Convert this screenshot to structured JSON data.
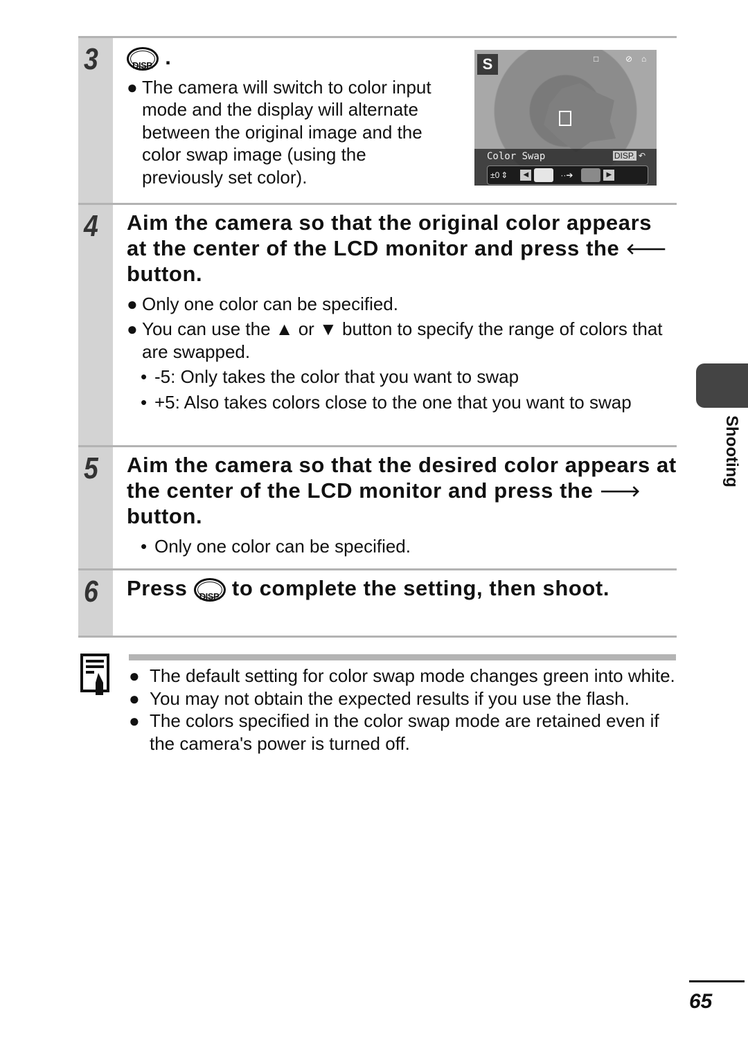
{
  "steps": [
    {
      "number": "3",
      "head_suffix": ".",
      "bullets": [
        "The camera will switch to color input mode and the display will alternate between the original image and the color swap image (using the previously set color)."
      ]
    },
    {
      "number": "4",
      "head_part1": "Aim the camera so that the original color appears at the center of the LCD monitor and press the",
      "head_arrow": "🡐",
      "head_part2": "button.",
      "bullets": [
        "Only one color can be specified.",
        "You can use the ▲ or ▼ button to specify the range of colors that are swapped."
      ],
      "subbullets": [
        "-5: Only takes the color that you want to swap",
        "+5: Also takes colors close to the one that you want to swap"
      ]
    },
    {
      "number": "5",
      "head_part1": "Aim the camera so that the desired color appears at the center of the LCD monitor and press the",
      "head_arrow": "🡒",
      "head_part2": "button.",
      "subbullets": [
        "Only one color can be specified."
      ]
    },
    {
      "number": "6",
      "head_part1": "Press",
      "head_part2": "to complete the setting, then shoot."
    }
  ],
  "disp_label": "DISP.",
  "lcd": {
    "mode_icon": "color-swap-mode",
    "title": "Color Swap",
    "disp_button": "DISP.",
    "range_value": "±0",
    "source_color": "#e6e6e6",
    "target_color": "#8a8a8a"
  },
  "notes": [
    "The default setting for color swap mode changes green into white.",
    "You may not obtain the expected results if you use the flash.",
    "The colors specified in the color swap mode are retained even if the camera's power is turned off."
  ],
  "side_tab": "Shooting",
  "page_number": "65",
  "bullet_glyph": "●",
  "sub_glyph": "•"
}
